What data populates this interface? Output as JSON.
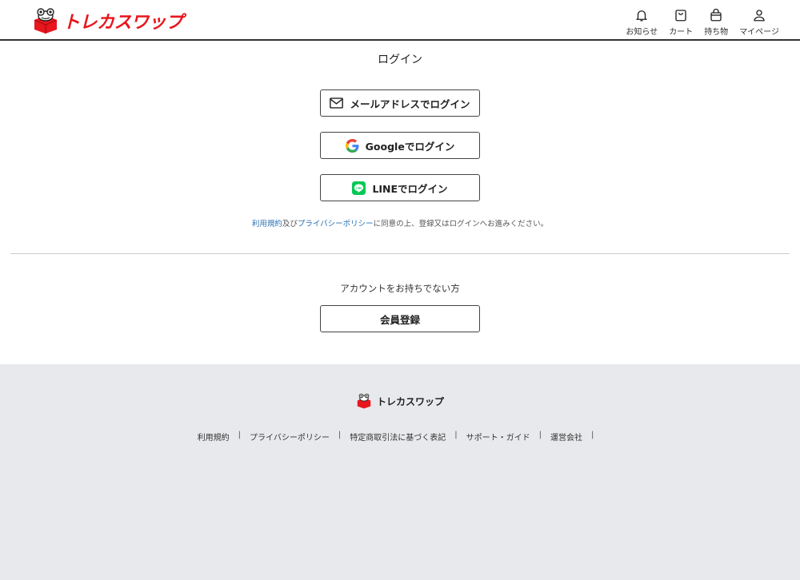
{
  "header": {
    "logo_text": "トレカスワップ",
    "nav": [
      {
        "label": "お知らせ",
        "icon": "bell-icon"
      },
      {
        "label": "カート",
        "icon": "cart-icon"
      },
      {
        "label": "持ち物",
        "icon": "bag-icon"
      },
      {
        "label": "マイページ",
        "icon": "user-icon"
      }
    ]
  },
  "main": {
    "title": "ログイン",
    "email_login": "メールアドレスでログイン",
    "google_login": "Googleでログイン",
    "line_login": "LINEでログイン",
    "terms": {
      "terms_link": "利用規約",
      "and": "及び",
      "privacy_link": "プライバシーポリシー",
      "rest": "に同意の上、登録又はログインへお進みください。"
    },
    "no_account": "アカウントをお持ちでない方",
    "register": "会員登録"
  },
  "footer": {
    "logo_text": "トレカスワップ",
    "links": [
      "利用規約",
      "プライバシーポリシー",
      "特定商取引法に基づく表記",
      "サポート・ガイド",
      "運営会社"
    ],
    "separator": "|"
  },
  "colors": {
    "brand_red": "#e8161d",
    "link_blue": "#2a6fb5",
    "line_green": "#06c755",
    "footer_bg": "#e8e9ec"
  }
}
